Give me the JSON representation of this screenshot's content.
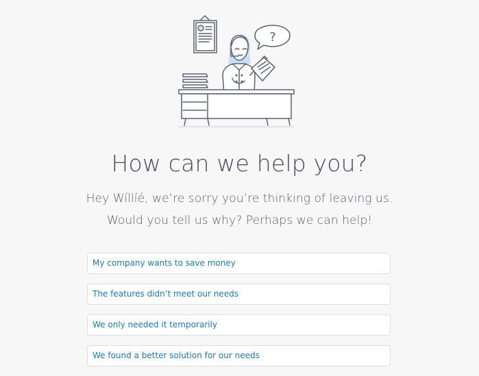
{
  "heading": "How can we help you?",
  "subtitle_line1": "Hey Wíllíé, we’re sorry you’re thinking of leaving us.",
  "subtitle_line2": "Would you tell us why? Perhaps we can help!",
  "illustration": {
    "speech_bubble_text": "?"
  },
  "options": [
    {
      "label": "My company wants to save money"
    },
    {
      "label": "The features didn’t meet our needs"
    },
    {
      "label": "We only needed it temporarily"
    },
    {
      "label": "We found a better solution for our needs"
    }
  ],
  "colors": {
    "background": "#f7f7f8",
    "link": "#1a78c7",
    "heading": "#474c54",
    "accent_light_blue": "#c7dff5"
  }
}
